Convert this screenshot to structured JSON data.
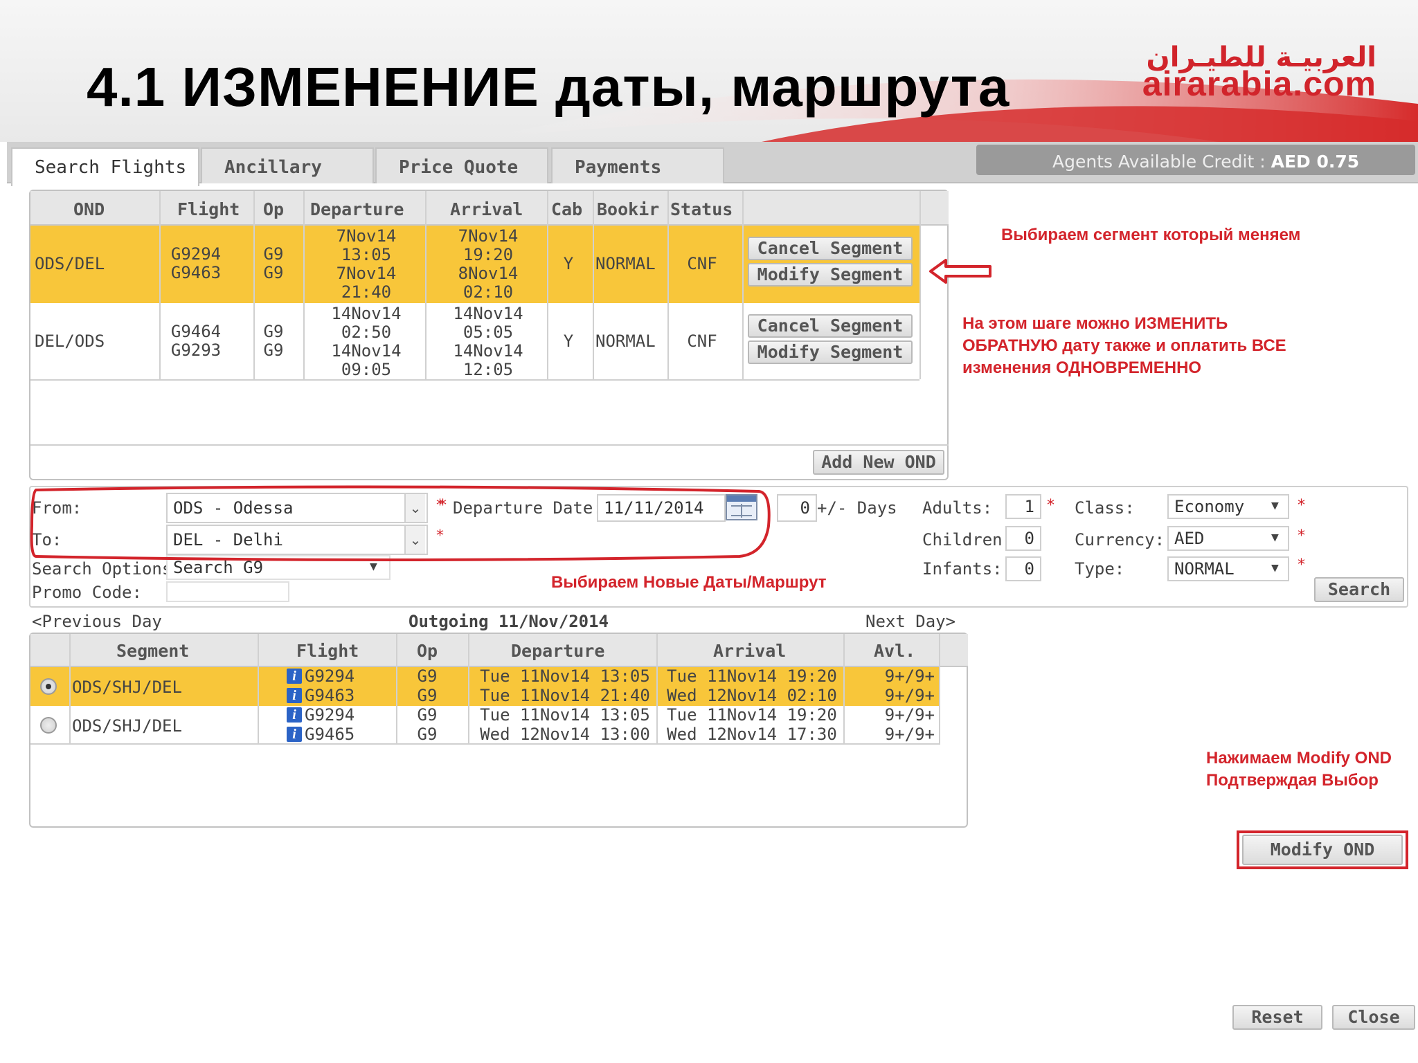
{
  "slide": {
    "title": "4.1 ИЗМЕНЕНИЕ даты, маршрута",
    "logo_arabic": "العربيـة للطيـران",
    "logo_text": "airarabia.com"
  },
  "tabs": [
    {
      "label": "Search Flights",
      "active": true
    },
    {
      "label": "Ancillary",
      "active": false
    },
    {
      "label": "Price Quote",
      "active": false
    },
    {
      "label": "Payments",
      "active": false
    }
  ],
  "credit": {
    "label": "Agents Available Credit :",
    "value": "AED 0.75"
  },
  "segments": {
    "columns": [
      "OND",
      "Flight",
      "Op",
      "Departure",
      "Arrival",
      "Cab",
      "Bookir",
      "Status"
    ],
    "rows": [
      {
        "ond": "ODS/DEL",
        "flights": [
          "G9294",
          "G9463"
        ],
        "ops": [
          "G9",
          "G9"
        ],
        "departure": [
          "7Nov14",
          "13:05",
          "7Nov14",
          "21:40"
        ],
        "arrival": [
          "7Nov14",
          "19:20",
          "8Nov14",
          "02:10"
        ],
        "cabin": "Y",
        "booking": "NORMAL",
        "status": "CNF",
        "cancel_label": "Cancel Segment",
        "modify_label": "Modify Segment"
      },
      {
        "ond": "DEL/ODS",
        "flights": [
          "G9464",
          "G9293"
        ],
        "ops": [
          "G9",
          "G9"
        ],
        "departure": [
          "14Nov14",
          "02:50",
          "14Nov14",
          "09:05"
        ],
        "arrival": [
          "14Nov14",
          "05:05",
          "14Nov14",
          "12:05"
        ],
        "cabin": "Y",
        "booking": "NORMAL",
        "status": "CNF",
        "cancel_label": "Cancel Segment",
        "modify_label": "Modify Segment"
      }
    ],
    "add_ond_label": "Add New OND"
  },
  "notes": {
    "select_segment": "Выбираем сегмент который меняем",
    "change_return_1": "На этом шаге можно ИЗМЕНИТЬ",
    "change_return_2": "ОБРАТНУЮ дату также и оплатить ВСЕ",
    "change_return_3": "изменения ОДНОВРЕМЕННО",
    "select_new": "Выбираем Новые Даты/Маршрут",
    "press_modify_1": "Нажимаем Modify OND",
    "press_modify_2": "Подтверждая Выбор"
  },
  "form": {
    "from_label": "From:",
    "from_value": "ODS - Odessa",
    "to_label": "To:",
    "to_value": "DEL - Delhi",
    "departure_label": "Departure Date:",
    "departure_value": "11/11/2014",
    "days_value": "0",
    "days_label": "+/- Days",
    "search_options_label": "Search Options",
    "search_options_value": "Search G9",
    "promo_label": "Promo Code:",
    "promo_value": "",
    "adults_label": "Adults:",
    "adults_value": "1",
    "children_label": "Children:",
    "children_value": "0",
    "infants_label": "Infants:",
    "infants_value": "0",
    "class_label": "Class:",
    "class_value": "Economy",
    "currency_label": "Currency:",
    "currency_value": "AED",
    "type_label": "Type:",
    "type_value": "NORMAL",
    "search_label": "Search",
    "required_mark": "*"
  },
  "results": {
    "prev_day": "<Previous Day",
    "heading": "Outgoing 11/Nov/2014",
    "next_day": "Next Day>",
    "columns": [
      "Segment",
      "Flight",
      "Op",
      "Departure",
      "Arrival",
      "Avl."
    ],
    "rows": [
      {
        "selected": true,
        "segment": "ODS/SHJ/DEL",
        "flights": [
          "G9294",
          "G9463"
        ],
        "ops": [
          "G9",
          "G9"
        ],
        "departure": [
          "Tue 11Nov14 13:05",
          "Tue 11Nov14 21:40"
        ],
        "arrival": [
          "Tue 11Nov14 19:20",
          "Wed 12Nov14 02:10"
        ],
        "avl": [
          "9+/9+",
          "9+/9+"
        ]
      },
      {
        "selected": false,
        "segment": "ODS/SHJ/DEL",
        "flights": [
          "G9294",
          "G9465"
        ],
        "ops": [
          "G9",
          "G9"
        ],
        "departure": [
          "Tue 11Nov14 13:05",
          "Wed 12Nov14 13:00"
        ],
        "arrival": [
          "Tue 11Nov14 19:20",
          "Wed 12Nov14 17:30"
        ],
        "avl": [
          "9+/9+",
          "9+/9+"
        ]
      }
    ]
  },
  "buttons": {
    "modify_ond": "Modify OND",
    "reset": "Reset",
    "close": "Close"
  },
  "colors": {
    "highlight": "#f8c63a",
    "annotation_red": "#d3242b",
    "brand_red": "#d1242b"
  }
}
